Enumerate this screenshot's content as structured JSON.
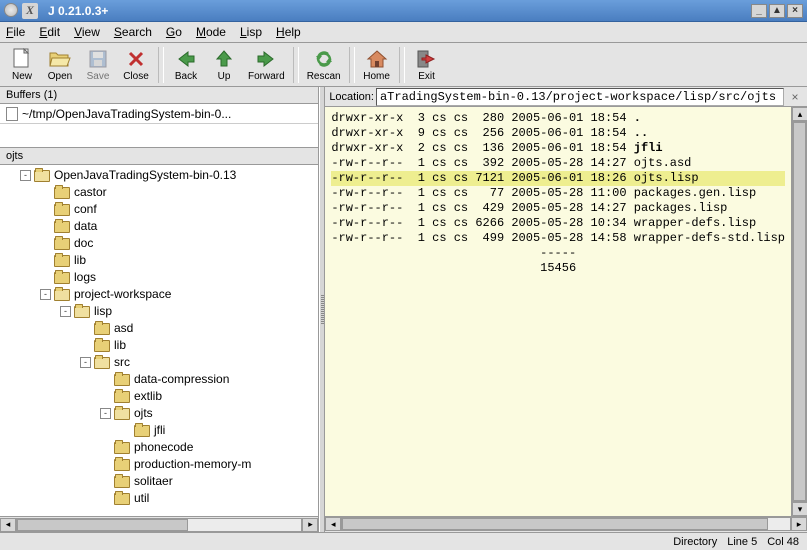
{
  "window": {
    "title": "J 0.21.0.3+"
  },
  "menu": {
    "file": "File",
    "edit": "Edit",
    "view": "View",
    "search": "Search",
    "go": "Go",
    "mode": "Mode",
    "lisp": "Lisp",
    "help": "Help"
  },
  "toolbar": {
    "new": "New",
    "open": "Open",
    "save": "Save",
    "close": "Close",
    "back": "Back",
    "up": "Up",
    "forward": "Forward",
    "rescan": "Rescan",
    "home": "Home",
    "exit": "Exit"
  },
  "buffers": {
    "header": "Buffers (1)",
    "item0": "~/tmp/OpenJavaTradingSystem-bin-0..."
  },
  "tree_header": "ojts",
  "tree": {
    "n0": "OpenJavaTradingSystem-bin-0.13",
    "n1": "castor",
    "n2": "conf",
    "n3": "data",
    "n4": "doc",
    "n5": "lib",
    "n6": "logs",
    "n7": "project-workspace",
    "n8": "lisp",
    "n9": "asd",
    "n10": "lib",
    "n11": "src",
    "n12": "data-compression",
    "n13": "extlib",
    "n14": "ojts",
    "n15": "jfli",
    "n16": "phonecode",
    "n17": "production-memory-m",
    "n18": "solitaer",
    "n19": "util"
  },
  "location": {
    "label": "Location:",
    "value": "aTradingSystem-bin-0.13/project-workspace/lisp/src/ojts"
  },
  "listing": {
    "l0": {
      "perms": "drwxr-xr-x",
      "links": "3",
      "own": "cs cs",
      "size": " 280",
      "date": "2005-06-01 18:54",
      "name": "."
    },
    "l1": {
      "perms": "drwxr-xr-x",
      "links": "9",
      "own": "cs cs",
      "size": " 256",
      "date": "2005-06-01 18:54",
      "name": ".."
    },
    "l2": {
      "perms": "drwxr-xr-x",
      "links": "2",
      "own": "cs cs",
      "size": " 136",
      "date": "2005-06-01 18:54",
      "name": "jfli"
    },
    "l3": {
      "perms": "-rw-r--r--",
      "links": "1",
      "own": "cs cs",
      "size": " 392",
      "date": "2005-05-28 14:27",
      "name": "ojts.asd"
    },
    "l4": {
      "perms": "-rw-r--r--",
      "links": "1",
      "own": "cs cs",
      "size": "7121",
      "date": "2005-06-01 18:26",
      "name": "ojts.lisp"
    },
    "l5": {
      "perms": "-rw-r--r--",
      "links": "1",
      "own": "cs cs",
      "size": "  77",
      "date": "2005-05-28 11:00",
      "name": "packages.gen.lisp"
    },
    "l6": {
      "perms": "-rw-r--r--",
      "links": "1",
      "own": "cs cs",
      "size": " 429",
      "date": "2005-05-28 14:27",
      "name": "packages.lisp"
    },
    "l7": {
      "perms": "-rw-r--r--",
      "links": "1",
      "own": "cs cs",
      "size": "6266",
      "date": "2005-05-28 10:34",
      "name": "wrapper-defs.lisp"
    },
    "l8": {
      "perms": "-rw-r--r--",
      "links": "1",
      "own": "cs cs",
      "size": " 499",
      "date": "2005-05-28 14:58",
      "name": "wrapper-defs-std.lisp"
    },
    "dashes": "-----",
    "total": "15456"
  },
  "status": {
    "mode": "Directory",
    "line": "Line 5",
    "col": "Col 48"
  }
}
